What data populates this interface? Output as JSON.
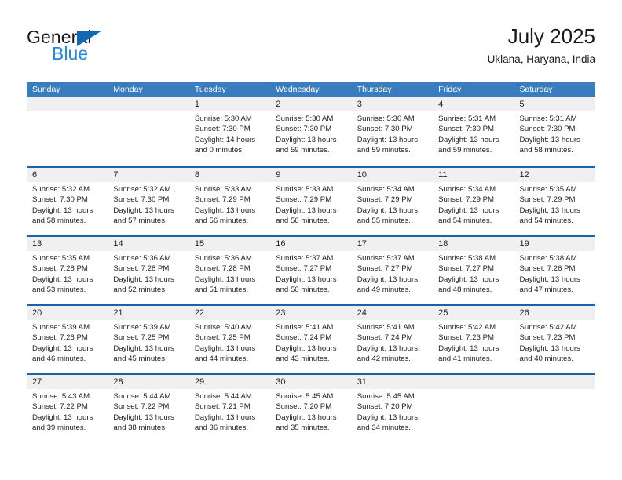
{
  "brand": {
    "name_part1": "General",
    "name_part2": "Blue",
    "triangle_icon": "triangle-icon",
    "color_dark": "#1a1a1a",
    "color_blue": "#2787d8",
    "color_triangle": "#1267b2"
  },
  "header": {
    "title": "July 2025",
    "subtitle": "Uklana, Haryana, India"
  },
  "theme": {
    "header_bar_bg": "#3a7dbf",
    "header_bar_text": "#ffffff",
    "week_divider": "#1664ab",
    "daynum_band_bg": "#f0f0f0",
    "body_text": "#222222"
  },
  "columns": [
    "Sunday",
    "Monday",
    "Tuesday",
    "Wednesday",
    "Thursday",
    "Friday",
    "Saturday"
  ],
  "weeks": [
    [
      {
        "day": "",
        "lines": []
      },
      {
        "day": "",
        "lines": []
      },
      {
        "day": "1",
        "lines": [
          "Sunrise: 5:30 AM",
          "Sunset: 7:30 PM",
          "Daylight: 14 hours",
          "and 0 minutes."
        ]
      },
      {
        "day": "2",
        "lines": [
          "Sunrise: 5:30 AM",
          "Sunset: 7:30 PM",
          "Daylight: 13 hours",
          "and 59 minutes."
        ]
      },
      {
        "day": "3",
        "lines": [
          "Sunrise: 5:30 AM",
          "Sunset: 7:30 PM",
          "Daylight: 13 hours",
          "and 59 minutes."
        ]
      },
      {
        "day": "4",
        "lines": [
          "Sunrise: 5:31 AM",
          "Sunset: 7:30 PM",
          "Daylight: 13 hours",
          "and 59 minutes."
        ]
      },
      {
        "day": "5",
        "lines": [
          "Sunrise: 5:31 AM",
          "Sunset: 7:30 PM",
          "Daylight: 13 hours",
          "and 58 minutes."
        ]
      }
    ],
    [
      {
        "day": "6",
        "lines": [
          "Sunrise: 5:32 AM",
          "Sunset: 7:30 PM",
          "Daylight: 13 hours",
          "and 58 minutes."
        ]
      },
      {
        "day": "7",
        "lines": [
          "Sunrise: 5:32 AM",
          "Sunset: 7:30 PM",
          "Daylight: 13 hours",
          "and 57 minutes."
        ]
      },
      {
        "day": "8",
        "lines": [
          "Sunrise: 5:33 AM",
          "Sunset: 7:29 PM",
          "Daylight: 13 hours",
          "and 56 minutes."
        ]
      },
      {
        "day": "9",
        "lines": [
          "Sunrise: 5:33 AM",
          "Sunset: 7:29 PM",
          "Daylight: 13 hours",
          "and 56 minutes."
        ]
      },
      {
        "day": "10",
        "lines": [
          "Sunrise: 5:34 AM",
          "Sunset: 7:29 PM",
          "Daylight: 13 hours",
          "and 55 minutes."
        ]
      },
      {
        "day": "11",
        "lines": [
          "Sunrise: 5:34 AM",
          "Sunset: 7:29 PM",
          "Daylight: 13 hours",
          "and 54 minutes."
        ]
      },
      {
        "day": "12",
        "lines": [
          "Sunrise: 5:35 AM",
          "Sunset: 7:29 PM",
          "Daylight: 13 hours",
          "and 54 minutes."
        ]
      }
    ],
    [
      {
        "day": "13",
        "lines": [
          "Sunrise: 5:35 AM",
          "Sunset: 7:28 PM",
          "Daylight: 13 hours",
          "and 53 minutes."
        ]
      },
      {
        "day": "14",
        "lines": [
          "Sunrise: 5:36 AM",
          "Sunset: 7:28 PM",
          "Daylight: 13 hours",
          "and 52 minutes."
        ]
      },
      {
        "day": "15",
        "lines": [
          "Sunrise: 5:36 AM",
          "Sunset: 7:28 PM",
          "Daylight: 13 hours",
          "and 51 minutes."
        ]
      },
      {
        "day": "16",
        "lines": [
          "Sunrise: 5:37 AM",
          "Sunset: 7:27 PM",
          "Daylight: 13 hours",
          "and 50 minutes."
        ]
      },
      {
        "day": "17",
        "lines": [
          "Sunrise: 5:37 AM",
          "Sunset: 7:27 PM",
          "Daylight: 13 hours",
          "and 49 minutes."
        ]
      },
      {
        "day": "18",
        "lines": [
          "Sunrise: 5:38 AM",
          "Sunset: 7:27 PM",
          "Daylight: 13 hours",
          "and 48 minutes."
        ]
      },
      {
        "day": "19",
        "lines": [
          "Sunrise: 5:38 AM",
          "Sunset: 7:26 PM",
          "Daylight: 13 hours",
          "and 47 minutes."
        ]
      }
    ],
    [
      {
        "day": "20",
        "lines": [
          "Sunrise: 5:39 AM",
          "Sunset: 7:26 PM",
          "Daylight: 13 hours",
          "and 46 minutes."
        ]
      },
      {
        "day": "21",
        "lines": [
          "Sunrise: 5:39 AM",
          "Sunset: 7:25 PM",
          "Daylight: 13 hours",
          "and 45 minutes."
        ]
      },
      {
        "day": "22",
        "lines": [
          "Sunrise: 5:40 AM",
          "Sunset: 7:25 PM",
          "Daylight: 13 hours",
          "and 44 minutes."
        ]
      },
      {
        "day": "23",
        "lines": [
          "Sunrise: 5:41 AM",
          "Sunset: 7:24 PM",
          "Daylight: 13 hours",
          "and 43 minutes."
        ]
      },
      {
        "day": "24",
        "lines": [
          "Sunrise: 5:41 AM",
          "Sunset: 7:24 PM",
          "Daylight: 13 hours",
          "and 42 minutes."
        ]
      },
      {
        "day": "25",
        "lines": [
          "Sunrise: 5:42 AM",
          "Sunset: 7:23 PM",
          "Daylight: 13 hours",
          "and 41 minutes."
        ]
      },
      {
        "day": "26",
        "lines": [
          "Sunrise: 5:42 AM",
          "Sunset: 7:23 PM",
          "Daylight: 13 hours",
          "and 40 minutes."
        ]
      }
    ],
    [
      {
        "day": "27",
        "lines": [
          "Sunrise: 5:43 AM",
          "Sunset: 7:22 PM",
          "Daylight: 13 hours",
          "and 39 minutes."
        ]
      },
      {
        "day": "28",
        "lines": [
          "Sunrise: 5:44 AM",
          "Sunset: 7:22 PM",
          "Daylight: 13 hours",
          "and 38 minutes."
        ]
      },
      {
        "day": "29",
        "lines": [
          "Sunrise: 5:44 AM",
          "Sunset: 7:21 PM",
          "Daylight: 13 hours",
          "and 36 minutes."
        ]
      },
      {
        "day": "30",
        "lines": [
          "Sunrise: 5:45 AM",
          "Sunset: 7:20 PM",
          "Daylight: 13 hours",
          "and 35 minutes."
        ]
      },
      {
        "day": "31",
        "lines": [
          "Sunrise: 5:45 AM",
          "Sunset: 7:20 PM",
          "Daylight: 13 hours",
          "and 34 minutes."
        ]
      },
      {
        "day": "",
        "lines": []
      },
      {
        "day": "",
        "lines": []
      }
    ]
  ]
}
